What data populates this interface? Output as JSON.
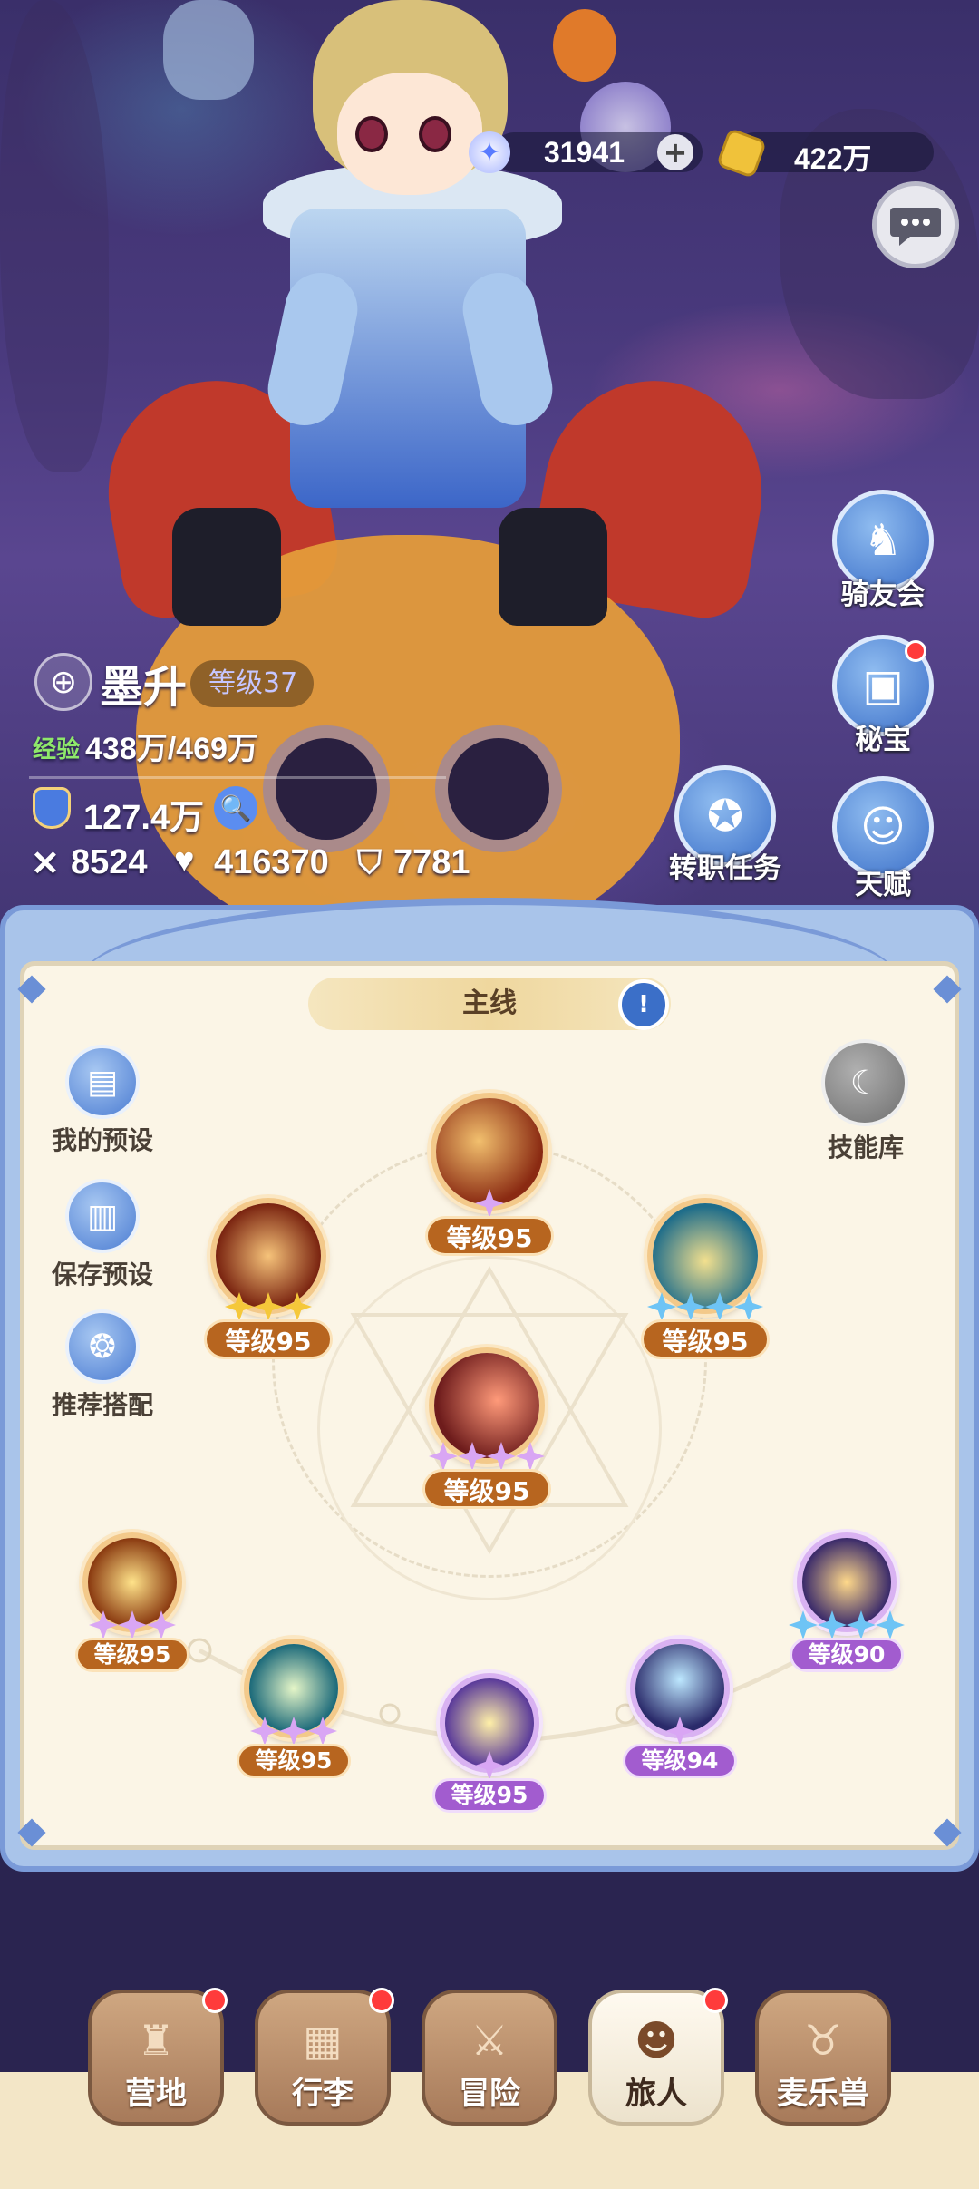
{
  "currency": {
    "gems": "31941",
    "coins": "422万"
  },
  "player": {
    "name": "墨升",
    "level_label": "等级37",
    "exp_label": "经验",
    "exp_value": "438万/469万",
    "power": "127.4万",
    "attack": "8524",
    "hp": "416370",
    "defense": "7781"
  },
  "side_menu": {
    "riders": "骑友会",
    "treasure": "秘宝",
    "job_quest": "转职任务",
    "talent": "天赋"
  },
  "panel": {
    "tab_title": "主线",
    "left_buttons": [
      "我的预设",
      "保存预设",
      "推荐搭配"
    ],
    "skill_library": "技能库"
  },
  "skills": [
    {
      "level": "等级95",
      "stars": 1,
      "star_color": "purple",
      "badge": "orange"
    },
    {
      "level": "等级95",
      "stars": 3,
      "star_color": "gold",
      "badge": "orange"
    },
    {
      "level": "等级95",
      "stars": 4,
      "star_color": "blue",
      "badge": "orange"
    },
    {
      "level": "等级95",
      "stars": 4,
      "star_color": "purple",
      "badge": "orange"
    },
    {
      "level": "等级95",
      "stars": 3,
      "star_color": "purple",
      "badge": "orange"
    },
    {
      "level": "等级95",
      "stars": 3,
      "star_color": "purple",
      "badge": "orange"
    },
    {
      "level": "等级95",
      "stars": 1,
      "star_color": "purple",
      "badge": "purple"
    },
    {
      "level": "等级94",
      "stars": 1,
      "star_color": "purple",
      "badge": "purple"
    },
    {
      "level": "等级90",
      "stars": 4,
      "star_color": "blue",
      "badge": "purple"
    }
  ],
  "nav": {
    "items": [
      "营地",
      "行李",
      "冒险",
      "旅人",
      "麦乐兽"
    ],
    "selected": "旅人"
  },
  "colors": {
    "level_orange": "#b7651f",
    "level_purple": "#a25ccf",
    "panel_bg": "#fbf5e6",
    "frame_blue": "#a9c4ea"
  }
}
